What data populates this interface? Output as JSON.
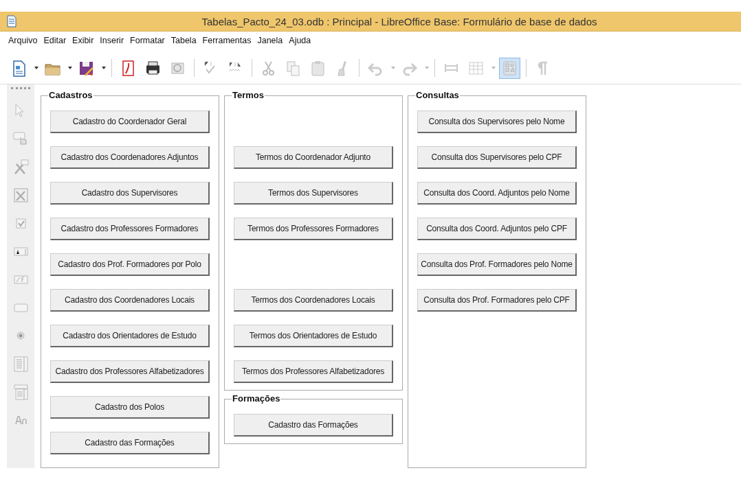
{
  "window": {
    "title": "Tabelas_Pacto_24_03.odb : Principal - LibreOffice Base: Formulário de base de dados"
  },
  "menu": [
    "Arquivo",
    "Editar",
    "Exibir",
    "Inserir",
    "Formatar",
    "Tabela",
    "Ferramentas",
    "Janela",
    "Ajuda"
  ],
  "toolbar": [
    {
      "kind": "new",
      "disabled": false,
      "dropdown": true
    },
    {
      "kind": "open",
      "disabled": false,
      "dropdown": true
    },
    {
      "kind": "save",
      "disabled": false,
      "dropdown": true
    },
    {
      "kind": "sep"
    },
    {
      "kind": "pdf",
      "disabled": false
    },
    {
      "kind": "print",
      "disabled": false
    },
    {
      "kind": "preview",
      "disabled": true
    },
    {
      "kind": "sep"
    },
    {
      "kind": "spell",
      "disabled": true
    },
    {
      "kind": "autospell",
      "disabled": true
    },
    {
      "kind": "sep"
    },
    {
      "kind": "cut",
      "disabled": true
    },
    {
      "kind": "copy",
      "disabled": true
    },
    {
      "kind": "paste",
      "disabled": true
    },
    {
      "kind": "brush",
      "disabled": true
    },
    {
      "kind": "sep"
    },
    {
      "kind": "undo",
      "disabled": true,
      "dropdown": true
    },
    {
      "kind": "redo",
      "disabled": true,
      "dropdown": true
    },
    {
      "kind": "sep"
    },
    {
      "kind": "navigator",
      "disabled": true
    },
    {
      "kind": "table",
      "disabled": true,
      "dropdown": true
    },
    {
      "kind": "design",
      "disabled": true,
      "on": true
    },
    {
      "kind": "sep"
    },
    {
      "kind": "pilcrow",
      "disabled": true
    }
  ],
  "form_controls": [
    {
      "kind": "select"
    },
    {
      "kind": "button"
    },
    {
      "kind": "design"
    },
    {
      "kind": "wizard"
    },
    {
      "kind": "checkbox"
    },
    {
      "kind": "textfield"
    },
    {
      "kind": "formatted"
    },
    {
      "kind": "pushbutton"
    },
    {
      "kind": "radio"
    },
    {
      "kind": "listbox"
    },
    {
      "kind": "combobox"
    },
    {
      "kind": "label"
    }
  ],
  "groups": [
    {
      "title": "Cadastros",
      "slots": [
        {
          "kind": "button",
          "label": "Cadastro do Coordenador Geral"
        },
        {
          "kind": "button",
          "label": "Cadastro dos Coordenadores Adjuntos"
        },
        {
          "kind": "button",
          "label": "Cadastro dos Supervisores"
        },
        {
          "kind": "button",
          "label": "Cadastro dos Professores Formadores"
        },
        {
          "kind": "button",
          "label": "Cadastro dos Prof. Formadores por Polo"
        },
        {
          "kind": "button",
          "label": "Cadastro dos Coordenadores Locais"
        },
        {
          "kind": "button",
          "label": "Cadastro dos Orientadores de Estudo"
        },
        {
          "kind": "button",
          "label": "Cadastro dos Professores Alfabetizadores"
        },
        {
          "kind": "button",
          "label": "Cadastro dos Polos"
        },
        {
          "kind": "button",
          "label": "Cadastro das Formações"
        }
      ]
    },
    {
      "title": "Termos",
      "slots": [
        {
          "kind": "gap"
        },
        {
          "kind": "button",
          "label": "Termos do Coordenador Adjunto"
        },
        {
          "kind": "button",
          "label": "Termos dos Supervisores"
        },
        {
          "kind": "button",
          "label": "Termos dos Professores Formadores"
        },
        {
          "kind": "gap"
        },
        {
          "kind": "button",
          "label": "Termos dos Coordenadores Locais"
        },
        {
          "kind": "button",
          "label": "Termos dos Orientadores de Estudo"
        },
        {
          "kind": "button",
          "label": "Termos dos Professores Alfabetizadores"
        }
      ]
    },
    {
      "title": "Formações",
      "slots": [
        {
          "kind": "button",
          "label": "Cadastro das Formações"
        }
      ]
    },
    {
      "title": "Consultas",
      "slots": [
        {
          "kind": "button",
          "label": "Consulta dos Supervisores pelo Nome"
        },
        {
          "kind": "button",
          "label": "Consulta dos Supervisores pelo CPF"
        },
        {
          "kind": "button",
          "label": "Consulta dos Coord. Adjuntos pelo Nome"
        },
        {
          "kind": "button",
          "label": "Consulta dos Coord. Adjuntos pelo CPF"
        },
        {
          "kind": "button",
          "label": "Consulta dos Prof. Formadores pelo Nome"
        },
        {
          "kind": "button",
          "label": "Consulta dos Prof. Formadores pelo CPF"
        }
      ]
    }
  ]
}
